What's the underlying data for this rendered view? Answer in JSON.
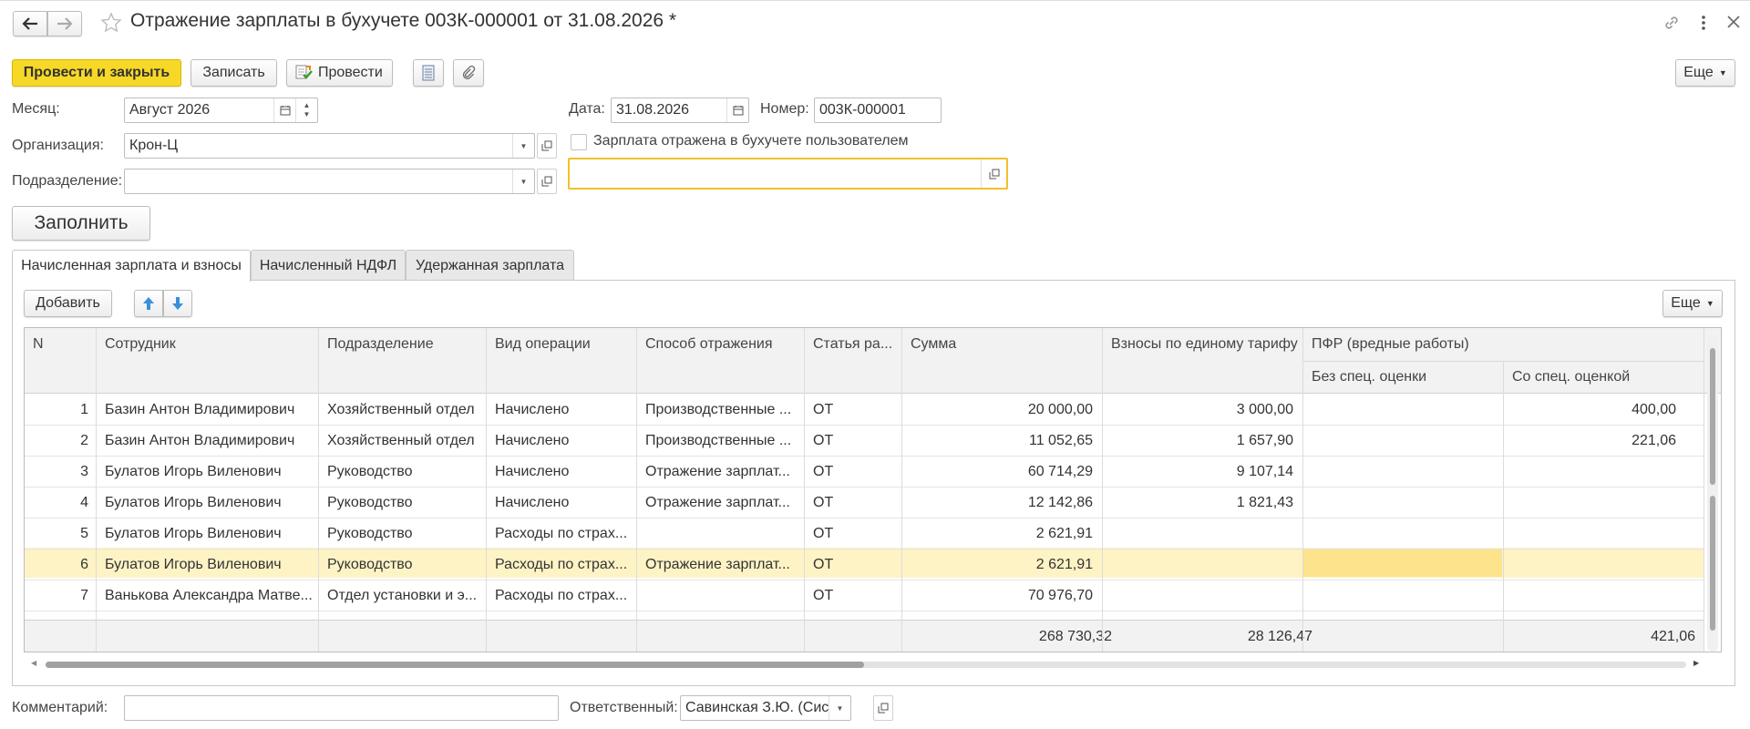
{
  "window": {
    "title": "Отражение зарплаты в бухучете 003К-000001 от 31.08.2026 *"
  },
  "toolbar": {
    "post_close": "Провести и закрыть",
    "save": "Записать",
    "post": "Провести",
    "more": "Еще"
  },
  "form": {
    "month_label": "Месяц:",
    "month_value": "Август 2026",
    "date_label": "Дата:",
    "date_value": "31.08.2026",
    "number_label": "Номер:",
    "number_value": "003К-000001",
    "org_label": "Организация:",
    "org_value": "Крон-Ц",
    "checkbox_label": "Зарплата отражена в бухучете пользователем",
    "dept_label": "Подразделение:",
    "dept_value": "",
    "fill_button": "Заполнить"
  },
  "tabs": [
    {
      "label": "Начисленная зарплата и взносы"
    },
    {
      "label": "Начисленный НДФЛ"
    },
    {
      "label": "Удержанная зарплата"
    }
  ],
  "table_toolbar": {
    "add": "Добавить",
    "more": "Еще"
  },
  "table": {
    "headers": {
      "n": "N",
      "employee": "Сотрудник",
      "dept": "Подразделение",
      "op": "Вид операции",
      "method": "Способ отражения",
      "article": "Статья ра...",
      "sum": "Сумма",
      "contrib": "Взносы по единому тарифу",
      "pfr": "ПФР (вредные работы)",
      "pfr_no": "Без спец. оценки",
      "pfr_with": "Со спец. оценкой"
    },
    "rows": [
      {
        "n": "1",
        "employee": "Базин Антон Владимирович",
        "dept": "Хозяйственный отдел",
        "op": "Начислено",
        "method": "Производственные ...",
        "article": "ОТ",
        "sum": "20 000,00",
        "contrib": "3 000,00",
        "pfr_no": "",
        "pfr_with": "400,00"
      },
      {
        "n": "2",
        "employee": "Базин Антон Владимирович",
        "dept": "Хозяйственный отдел",
        "op": "Начислено",
        "method": "Производственные ...",
        "article": "ОТ",
        "sum": "11 052,65",
        "contrib": "1 657,90",
        "pfr_no": "",
        "pfr_with": "221,06"
      },
      {
        "n": "3",
        "employee": "Булатов Игорь Виленович",
        "dept": "Руководство",
        "op": "Начислено",
        "method": "Отражение зарплат...",
        "article": "ОТ",
        "sum": "60 714,29",
        "contrib": "9 107,14",
        "pfr_no": "",
        "pfr_with": ""
      },
      {
        "n": "4",
        "employee": "Булатов Игорь Виленович",
        "dept": "Руководство",
        "op": "Начислено",
        "method": "Отражение зарплат...",
        "article": "ОТ",
        "sum": "12 142,86",
        "contrib": "1 821,43",
        "pfr_no": "",
        "pfr_with": ""
      },
      {
        "n": "5",
        "employee": "Булатов Игорь Виленович",
        "dept": "Руководство",
        "op": "Расходы по страх...",
        "method": "",
        "article": "ОТ",
        "sum": "2 621,91",
        "contrib": "",
        "pfr_no": "",
        "pfr_with": ""
      },
      {
        "n": "6",
        "employee": "Булатов Игорь Виленович",
        "dept": "Руководство",
        "op": "Расходы по страх...",
        "method": "Отражение зарплат...",
        "article": "ОТ",
        "sum": "2 621,91",
        "contrib": "",
        "pfr_no": "",
        "pfr_with": ""
      },
      {
        "n": "7",
        "employee": "Ванькова Александра Матве...",
        "dept": "Отдел установки и э...",
        "op": "Расходы по страх...",
        "method": "",
        "article": "ОТ",
        "sum": "70 976,70",
        "contrib": "",
        "pfr_no": "",
        "pfr_with": ""
      }
    ],
    "footer": {
      "sum": "268 730,32",
      "contrib": "28 126,47",
      "pfr_with": "421,06"
    }
  },
  "bottom": {
    "comment_label": "Комментарий:",
    "comment_value": "",
    "resp_label": "Ответственный:",
    "resp_value": "Савинская З.Ю. (Систем"
  },
  "colors": {
    "primary_button": "#f7d827",
    "selected_row": "#fdf3c5",
    "selected_cell": "#fde38b",
    "focus_border": "#f2c02c"
  }
}
